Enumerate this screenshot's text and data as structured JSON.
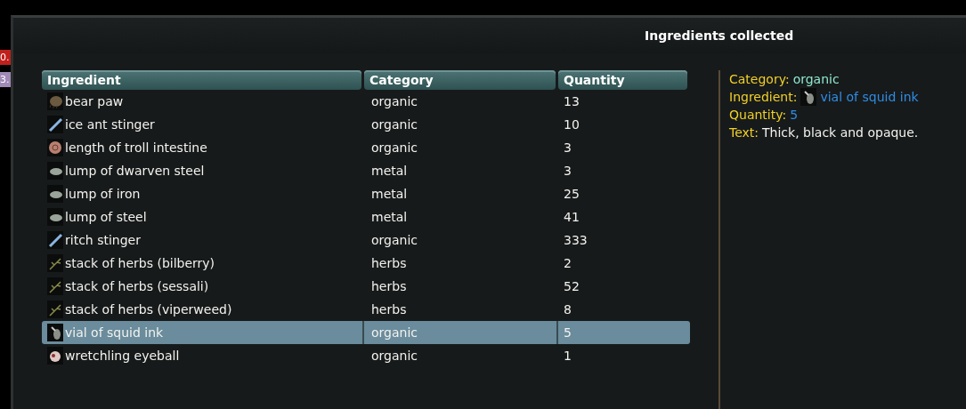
{
  "hud": {
    "badges": [
      {
        "text": "0.",
        "color": "#c0201c"
      },
      {
        "text": "3.",
        "color": "#a08ab8"
      }
    ]
  },
  "window": {
    "title": "Ingredients collected"
  },
  "table": {
    "columns": [
      "Ingredient",
      "Category",
      "Quantity"
    ],
    "rows": [
      {
        "kind": "paw",
        "name": "bear paw",
        "category": "organic",
        "quantity": "13",
        "selected": false
      },
      {
        "kind": "stinger",
        "name": "ice ant stinger",
        "category": "organic",
        "quantity": "10",
        "selected": false
      },
      {
        "kind": "coil",
        "name": "length of troll intestine",
        "category": "organic",
        "quantity": "3",
        "selected": false
      },
      {
        "kind": "ore",
        "name": "lump of dwarven steel",
        "category": "metal",
        "quantity": "3",
        "selected": false
      },
      {
        "kind": "ore",
        "name": "lump of iron",
        "category": "metal",
        "quantity": "25",
        "selected": false
      },
      {
        "kind": "ore",
        "name": "lump of steel",
        "category": "metal",
        "quantity": "41",
        "selected": false
      },
      {
        "kind": "stinger",
        "name": "ritch stinger",
        "category": "organic",
        "quantity": "333",
        "selected": false
      },
      {
        "kind": "herb",
        "name": "stack of herbs (bilberry)",
        "category": "herbs",
        "quantity": "2",
        "selected": false
      },
      {
        "kind": "herb",
        "name": "stack of herbs (sessali)",
        "category": "herbs",
        "quantity": "52",
        "selected": false
      },
      {
        "kind": "herb",
        "name": "stack of herbs (viperweed)",
        "category": "herbs",
        "quantity": "8",
        "selected": false
      },
      {
        "kind": "vial",
        "name": "vial of squid ink",
        "category": "organic",
        "quantity": "5",
        "selected": true
      },
      {
        "kind": "eyeball",
        "name": "wretchling eyeball",
        "category": "organic",
        "quantity": "1",
        "selected": false
      }
    ]
  },
  "details": [
    {
      "kind": "category",
      "label": "Category:",
      "value": "organic"
    },
    {
      "kind": "link",
      "label": "Ingredient:",
      "value": "vial of squid ink"
    },
    {
      "kind": "number",
      "label": "Quantity:",
      "value": "5"
    },
    {
      "kind": "text",
      "label": "Text:",
      "value": "Thick, black and opaque."
    }
  ]
}
